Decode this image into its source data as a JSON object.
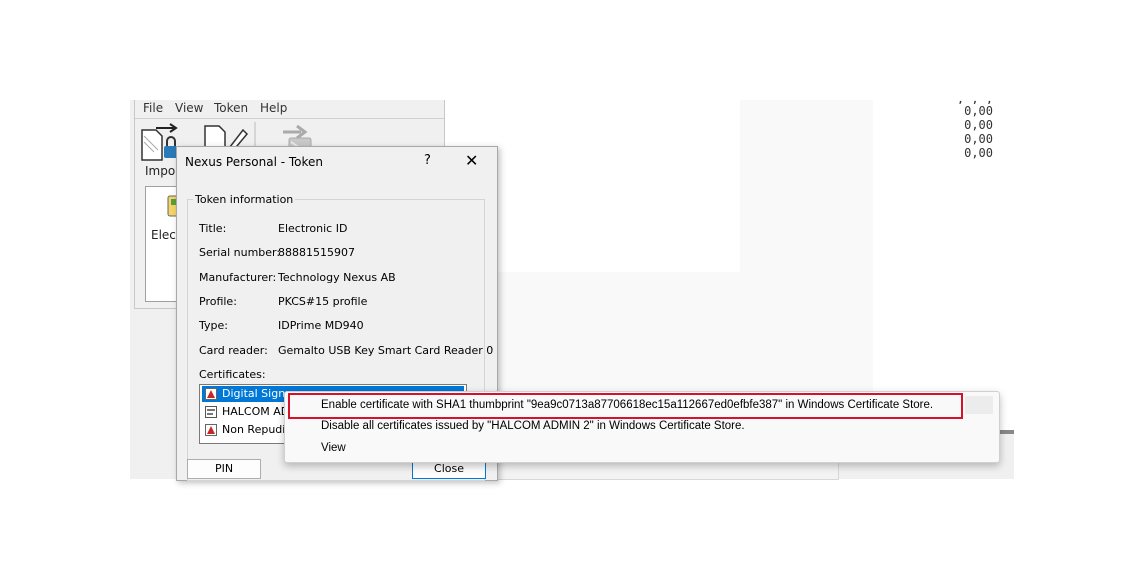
{
  "menubar": {
    "items": [
      "File",
      "View",
      "Token",
      "Help"
    ]
  },
  "toolbar": {
    "import_label": "Impor"
  },
  "main_panel": {
    "item_label": "Elect"
  },
  "background": {
    "numbers": [
      ", , ,",
      "0,00",
      "0,00",
      "0,00",
      "0,00"
    ]
  },
  "dialog": {
    "title": "Nexus Personal - Token",
    "help": "?",
    "close_icon": "✕",
    "group_title": "Token information",
    "fields": [
      {
        "label": "Title:",
        "value": "Electronic ID"
      },
      {
        "label": "Serial number:",
        "value": "88881515907"
      },
      {
        "label": "Manufacturer:",
        "value": "Technology Nexus AB"
      },
      {
        "label": "Profile:",
        "value": "PKCS#15 profile"
      },
      {
        "label": "Type:",
        "value": "IDPrime MD940"
      },
      {
        "label": "Card reader:",
        "value": "Gemalto USB Key Smart Card Reader 0"
      }
    ],
    "certificates_label": "Certificates:",
    "certificates": [
      "Digital Signa",
      "HALCOM AD",
      "Non Repudia"
    ],
    "pin_button": "PIN",
    "close_button": "Close"
  },
  "context_menu": {
    "items": [
      "Enable certificate with SHA1 thumbprint \"9ea9c0713a87706618ec15a112667ed0efbfe387\" in Windows Certificate Store.",
      "Disable all certificates issued by \"HALCOM ADMIN 2\" in Windows Certificate Store.",
      "View"
    ]
  },
  "colors": {
    "selection": "#0078d7",
    "highlight": "#d8112b"
  }
}
